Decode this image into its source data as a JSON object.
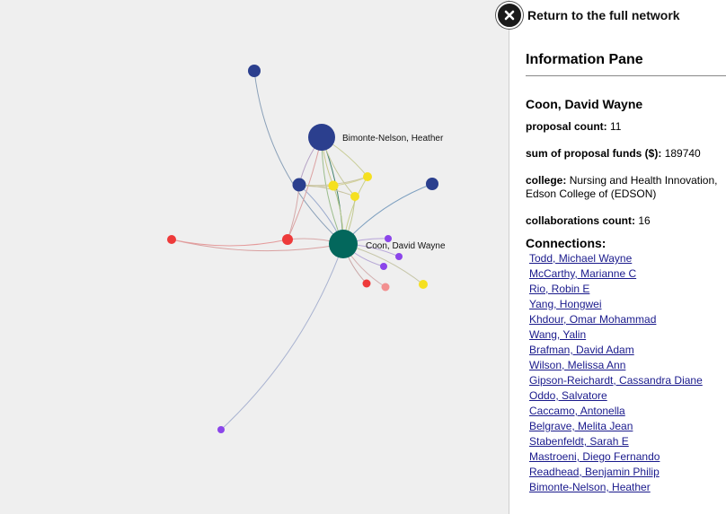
{
  "header": {
    "return_label": "Return to the full network"
  },
  "pane": {
    "title": "Information Pane",
    "node_name": "Coon, David Wayne",
    "fields": [
      {
        "label": "proposal count:",
        "value": "11"
      },
      {
        "label": "sum of proposal funds ($):",
        "value": "189740"
      },
      {
        "label": "college:",
        "value": "Nursing and Health Innovation, Edson College of (EDSON)"
      },
      {
        "label": "collaborations count:",
        "value": "16"
      }
    ],
    "connections_title": "Connections:",
    "connections": [
      "Todd, Michael Wayne",
      "McCarthy, Marianne C",
      "Rio, Robin E",
      "Yang, Hongwei",
      "Khdour, Omar Mohammad",
      "Wang, Yalin",
      "Brafman, David Adam",
      "Wilson, Melissa Ann",
      "Gipson-Reichardt, Cassandra Diane",
      "Oddo, Salvatore",
      "Caccamo, Antonella",
      "Belgrave, Melita Jean",
      "Stabenfeldt, Sarah E",
      "Mastroeni, Diego Fernando",
      "Readhead, Benjamin Philip",
      "Bimonte-Nelson, Heather"
    ]
  },
  "graph": {
    "colors": {
      "teal": "#03675c",
      "navy": "#2b3f8e",
      "yellow": "#f5e020",
      "red": "#ee3a3a",
      "purple": "#8b45ea",
      "pink": "#f29090"
    },
    "labels": {
      "center": "Coon, David Wayne",
      "hub": "Bimonte-Nelson, Heather"
    }
  }
}
